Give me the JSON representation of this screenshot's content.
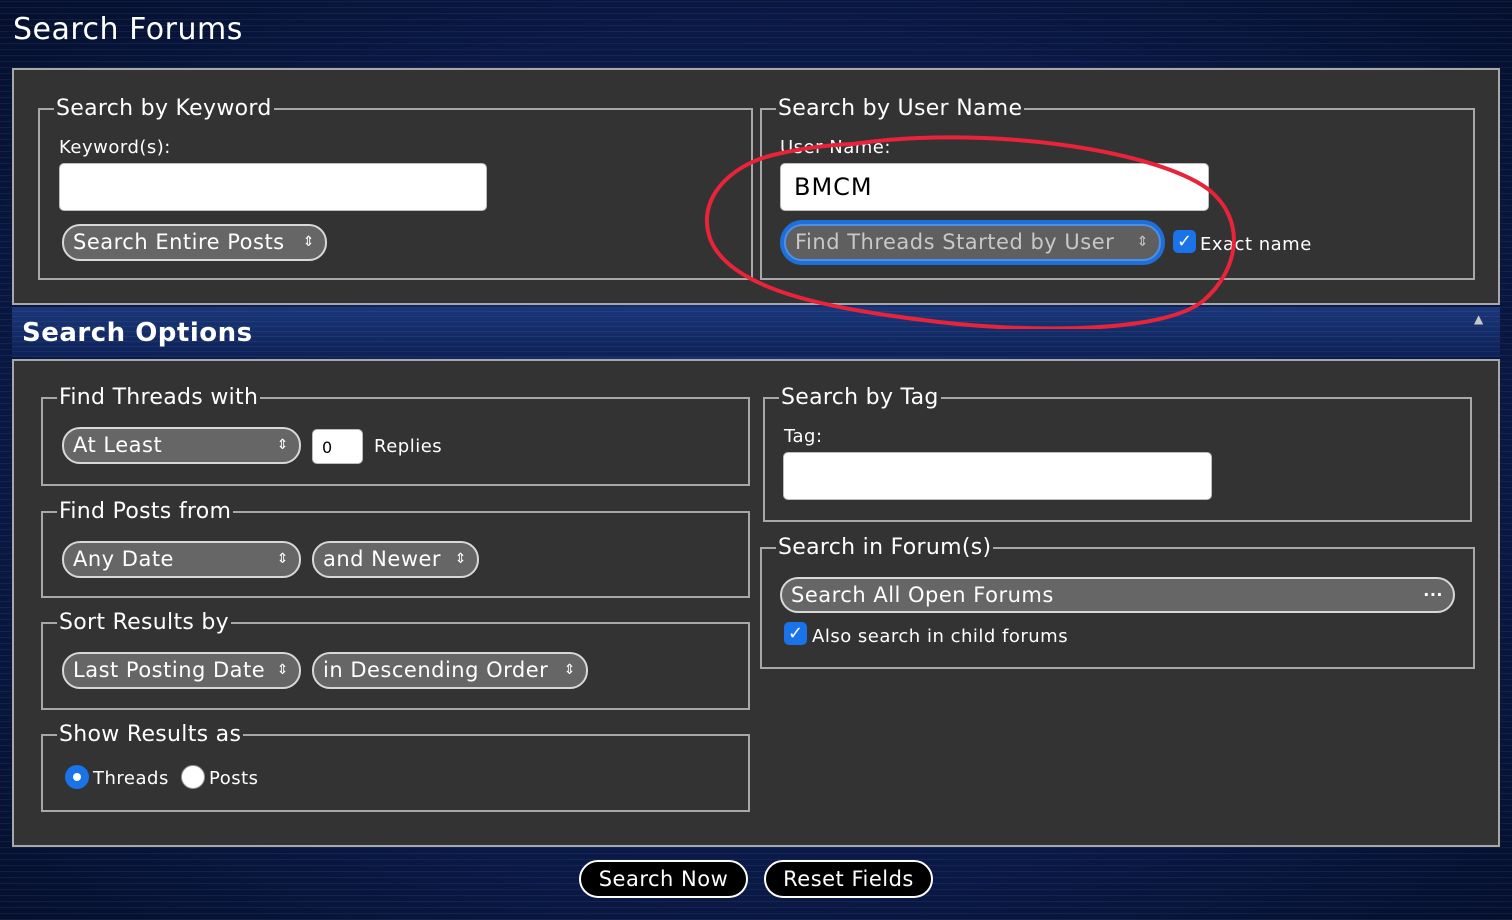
{
  "window_title": "Search Forums",
  "keyword_group": {
    "legend": "Search by Keyword",
    "label": "Keyword(s):",
    "value": "",
    "mode_select": "Search Entire Posts"
  },
  "user_group": {
    "legend": "Search by User Name",
    "label": "User Name:",
    "value": "BMCM",
    "mode_select": "Find Threads Started by User",
    "exact_name_label": "Exact name",
    "exact_name_checked": true
  },
  "options_bar": {
    "title": "Search Options",
    "collapse_icon": "▲"
  },
  "find_threads": {
    "legend": "Find Threads with",
    "qualifier_select": "At Least",
    "replies_value": "0",
    "replies_label": "Replies"
  },
  "find_posts": {
    "legend": "Find Posts from",
    "date_select": "Any Date",
    "direction_select": "and Newer"
  },
  "sort_results": {
    "legend": "Sort Results by",
    "field_select": "Last Posting Date",
    "order_select": "in Descending Order"
  },
  "show_results": {
    "legend": "Show Results as",
    "threads_label": "Threads",
    "posts_label": "Posts",
    "selected": "Threads"
  },
  "tag_group": {
    "legend": "Search by Tag",
    "label": "Tag:",
    "value": ""
  },
  "forum_group": {
    "legend": "Search in Forum(s)",
    "forum_select": "Search All Open Forums",
    "more_icon": "···",
    "child_forums_label": "Also search in child forums",
    "child_forums_checked": true
  },
  "actions": {
    "search_now": "Search Now",
    "reset_fields": "Reset Fields"
  },
  "colors": {
    "panel": "#333333",
    "accent_blue": "#1a73e8",
    "annotation_red": "#e8233a"
  }
}
